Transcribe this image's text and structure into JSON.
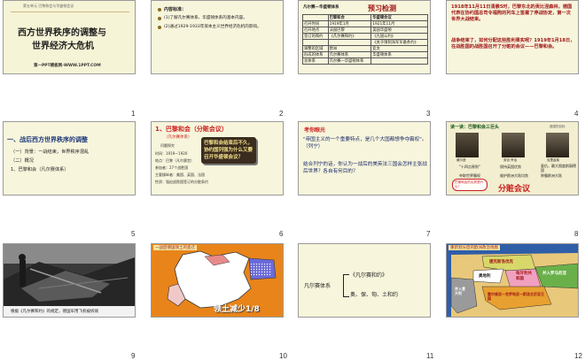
{
  "slides": [
    {
      "num": "1",
      "header": "第五单元 巴黎和会与华盛顿会议",
      "title_l1": "西方世界秩序的调整与",
      "title_l2": "世界经济大危机",
      "footer": "第一PPT模板网-WWW.1PPT.COM"
    },
    {
      "num": "2",
      "bullet1": "内容标准：",
      "bullet2": "(1)了解凡尔赛体系、华盛顿体系的基本内容。",
      "bullet3": "(2)通过1929-1933年资本主义世界经济危机的影响。"
    },
    {
      "num": "3",
      "tag": "凡尔赛—华盛顿体系",
      "heading": "预习检测",
      "table": [
        [
          "",
          "巴黎和会",
          "华盛顿会议"
        ],
        [
          "召开时间",
          "1919年1月",
          "1921年11月"
        ],
        [
          "召开地点",
          "法国巴黎",
          "美国华盛顿"
        ],
        [
          "签订的和约",
          "《凡尔赛和约》",
          "《九国公约》"
        ],
        [
          "",
          "",
          "《关于限制海军军备条约》"
        ],
        [
          "调整的区域",
          "欧洲",
          "亚太"
        ],
        [
          "形成的体系",
          "凡尔赛体系",
          "华盛顿体系"
        ],
        [
          "总体系",
          "凡尔赛—华盛顿体系",
          ""
        ]
      ]
    },
    {
      "num": "4",
      "para1": "1918年11月11日清晨5时，巴黎东北的贡比涅森林，德国代表在协约国总司令福煦的列车上签署了停战协定，第一次世界大战结束。",
      "para2": "战争结束了，如何分配这些胜利果实呢？1919年1月18日，在战胜国的战胜国召开了分赃的会议——巴黎和会。"
    },
    {
      "num": "5",
      "heading": "一、战后西方世界秩序的调整",
      "item1": "（一）背景：一战结束，世界秩序混乱",
      "item2": "（二）概况",
      "item3": "1、巴黎和会（凡尔赛体系）"
    },
    {
      "num": "6",
      "heading": "1、巴黎和会（分赃会议）",
      "sub": "（凡尔赛体系）",
      "bubble": "巴黎和会结束后不久，协约国列强为什么又要召开华盛顿会议？",
      "l1": "问题探究",
      "l2": "时间：1919—1920",
      "l3": "地点：巴黎（凡尔赛宫）",
      "l4": "参加者：27个战胜国",
      "l5": "主要操纵者：美国、英国、法国",
      "l6": "性质：强迫战败国签订的分赃条约"
    },
    {
      "num": "7",
      "heading": "考你眼光",
      "q1": "\"帝国主义的一个重要特点，是几个大国都想争夺霸权\"。（列宁）",
      "q2": "结合列宁的话，你认为一战后的美英法三国会怎样主张战后世界？各自有何目的？"
    },
    {
      "num": "8",
      "heading": "读一读：巴黎和会三巨头",
      "tag": "各国的目标",
      "p1": "威尔逊",
      "p2": "劳合·乔治",
      "p3": "克里孟梭",
      "g1": "\"十四点原则\"",
      "g2": "保持英国优势",
      "g3": "复仇，最大限度削弱德国",
      "g4": "夺取世界霸权",
      "g5": "维护欧洲大陆均势",
      "g6": "称霸欧洲大陆",
      "bubble": "巴黎和会的实质是什么？",
      "big": "分赃会议"
    },
    {
      "num": "9",
      "caption": "根据《凡尔赛和约》的规定，德国军用飞机被拆毁"
    },
    {
      "num": "10",
      "header": "一战后德国领土的变迁",
      "label": "领土减少1/8"
    },
    {
      "num": "11",
      "left": "凡尔赛体系",
      "r1": "《凡尔赛和约》",
      "r2": "奥、保、匈、土和约"
    },
    {
      "num": "12",
      "header": "重新划分后的欧洲政治地图",
      "c1": "捷克斯洛伐克",
      "c2": "奥地利",
      "c3": "匈牙利共和国",
      "c4": "并入罗马尼亚",
      "c5": "并入意大利",
      "c6": "塞尔维亚—克罗地亚—斯洛文尼亚王国"
    }
  ],
  "colors": {
    "accent_red": "#cc1f1f",
    "dark_red": "#a01818",
    "map_orange": "#e8841a",
    "sea_blue": "#2f5ea8",
    "slide_bg": "#f7f5dc"
  }
}
